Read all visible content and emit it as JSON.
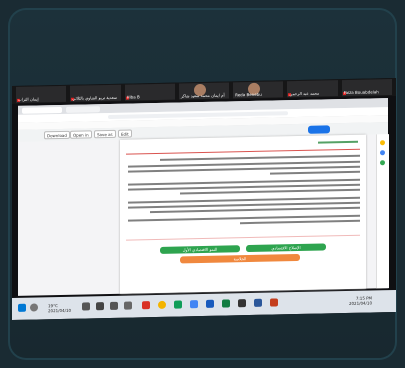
{
  "zoom": {
    "participants": [
      {
        "name": "إيمان التراب"
      },
      {
        "name": "سعدية تربو الشاوي بالثلاثي"
      },
      {
        "name": "Hiba B"
      },
      {
        "name": "أم ايمان محمد سعيد شاكر"
      },
      {
        "name": "Reda Benebu"
      },
      {
        "name": "محمد عبد الرحمن"
      },
      {
        "name": "Faiza Bouabdelah"
      }
    ]
  },
  "browser": {
    "tool_buttons": [
      "Download",
      "Open in",
      "Save as",
      "Edit"
    ],
    "share_label": "Share"
  },
  "document": {
    "heading": "ثانياً الإصلاح الاقتصادي",
    "buttons": [
      {
        "label": "النمو الاقتصادي الأول",
        "color": "#2ea44f"
      },
      {
        "label": "الإصلاح الاقتصادي",
        "color": "#2ea44f"
      },
      {
        "label": "الخلاصة",
        "color": "#f0883e"
      }
    ]
  },
  "taskbar": {
    "weather": "19°C",
    "date_left": "2021/04/10",
    "time_right": "7:15 PM",
    "date_right": "2021/04/10"
  },
  "colors": {
    "photo_frame": "#1c313a",
    "screen_bg": "#0f0f12",
    "taskbar": "#dde3ea",
    "accent_blue": "#1a73e8",
    "green": "#2ea44f",
    "orange": "#f0883e"
  }
}
